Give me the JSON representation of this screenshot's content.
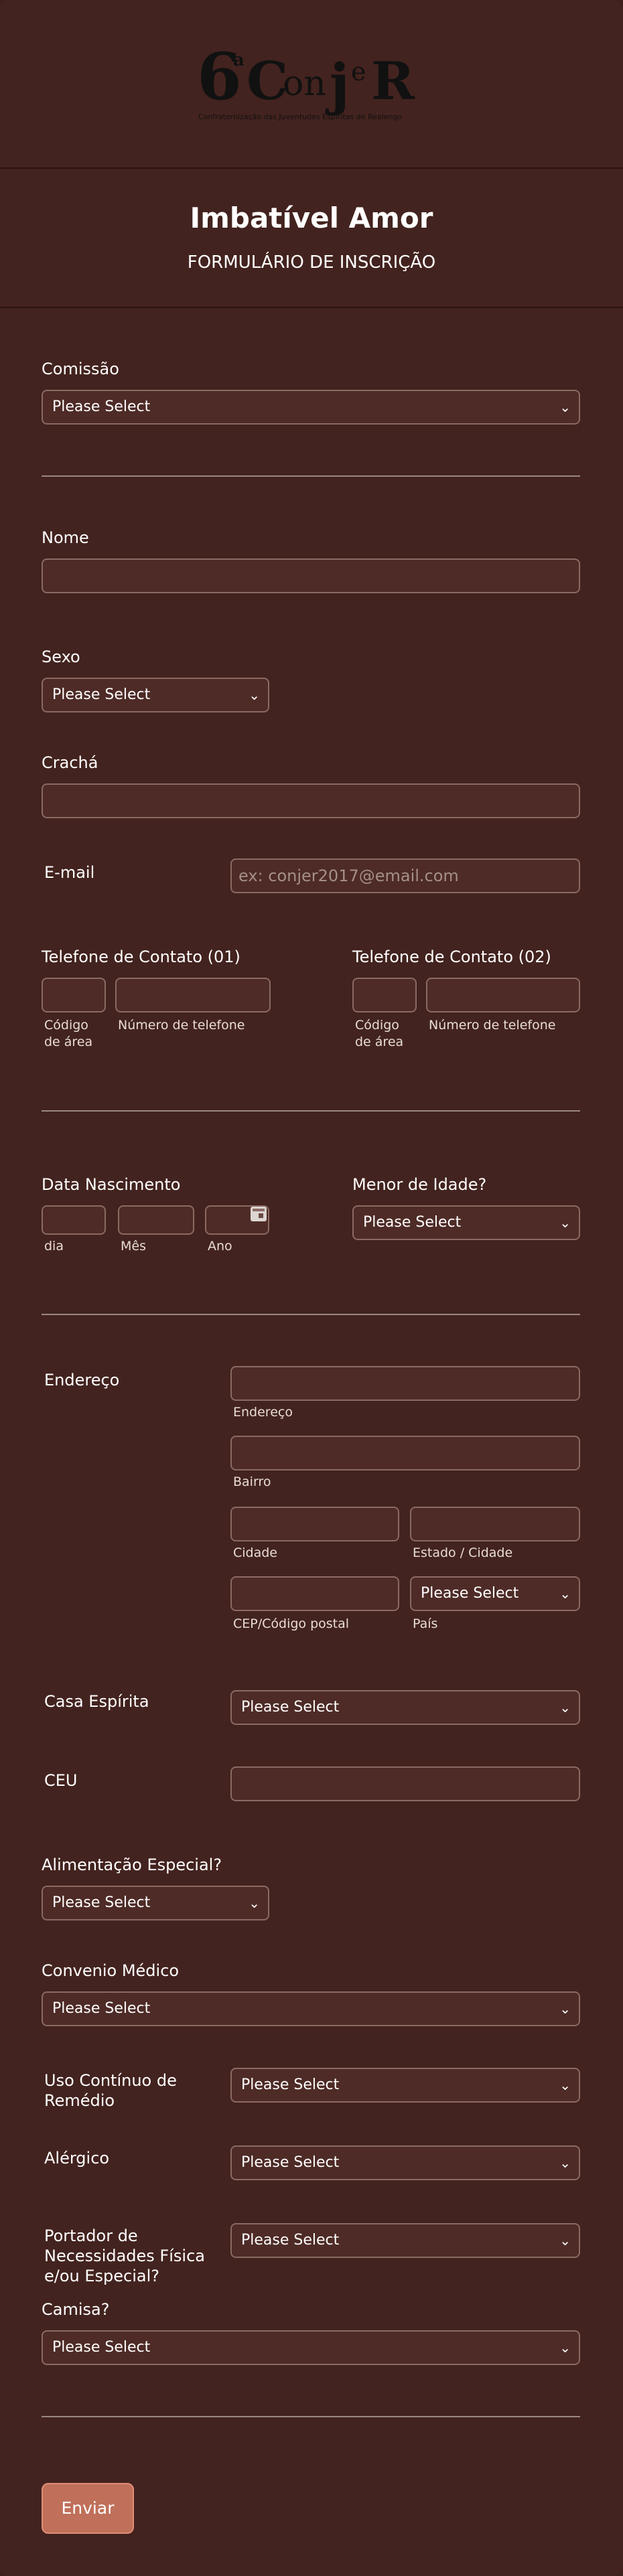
{
  "header": {
    "logo_number": "6",
    "logo_superscript": "a",
    "logo_word": "Conjer",
    "logo_tagline": "Confraternização das Juventudes Espíritas de Realengo",
    "title": "Imbatível Amor",
    "subtitle": "FORMULÁRIO DE INSCRIÇÃO"
  },
  "form": {
    "comissao": {
      "label": "Comissão",
      "value": "Please Select"
    },
    "nome": {
      "label": "Nome"
    },
    "sexo": {
      "label": "Sexo",
      "value": "Please Select"
    },
    "cracha": {
      "label": "Crachá"
    },
    "email": {
      "label": "E-mail",
      "placeholder": "ex: conjer2017@email.com"
    },
    "telefone1": {
      "label": "Telefone de Contato (01)",
      "area_line1": "Código",
      "area_line2": "de área",
      "number": "Número de telefone"
    },
    "telefone2": {
      "label": "Telefone de Contato (02)",
      "area_line1": "Código",
      "area_line2": "de área",
      "number": "Número de telefone"
    },
    "nascimento": {
      "label": "Data Nascimento",
      "dia": "dia",
      "mes": "Mês",
      "ano": "Ano"
    },
    "menor": {
      "label": "Menor de Idade?",
      "value": "Please Select"
    },
    "endereco": {
      "label": "Endereço",
      "street": "Endereço",
      "bairro": "Bairro",
      "cidade": "Cidade",
      "estado": "Estado / Cidade",
      "cep": "CEP/Código postal",
      "pais": "País",
      "pais_value": "Please Select"
    },
    "casa_espirita": {
      "label": "Casa Espírita",
      "value": "Please Select"
    },
    "ceu": {
      "label": "CEU"
    },
    "alimentacao": {
      "label": "Alimentação Especial?",
      "value": "Please Select"
    },
    "convenio": {
      "label": "Convenio Médico",
      "value": "Please Select"
    },
    "remedio": {
      "label_line1": "Uso Contínuo de",
      "label_line2": "Remédio",
      "value": "Please Select"
    },
    "alergico": {
      "label": "Alérgico",
      "value": "Please Select"
    },
    "necessidades": {
      "label_line1": "Portador de",
      "label_line2": "Necessidades Física",
      "label_line3": "e/ou Especial?",
      "value": "Please Select"
    },
    "camisa": {
      "label": "Camisa?",
      "value": "Please Select"
    },
    "submit_label": "Enviar"
  }
}
